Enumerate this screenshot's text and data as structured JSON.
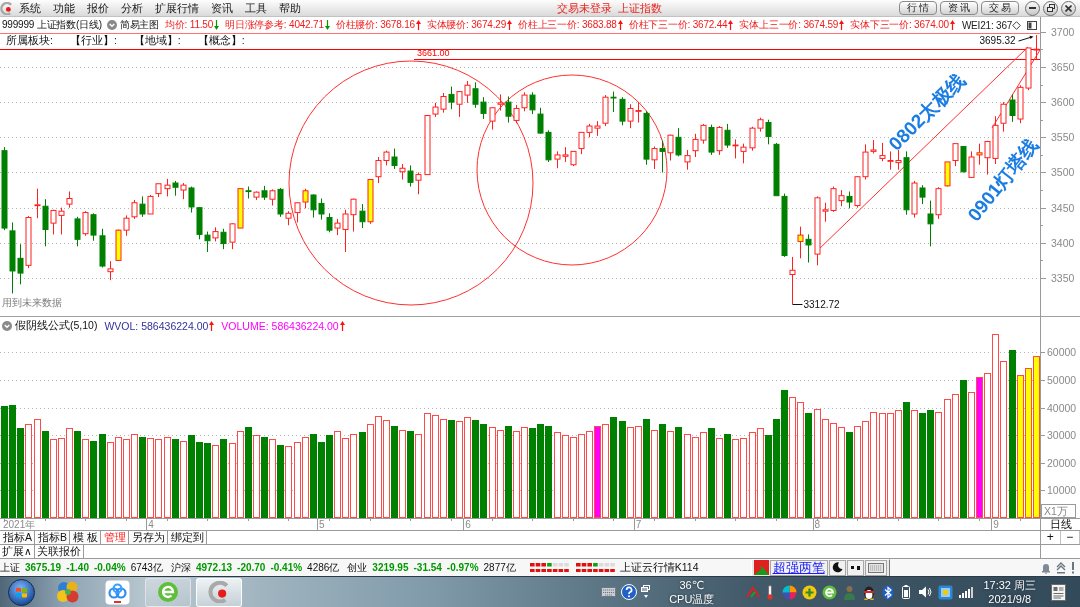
{
  "title_bar": {
    "menu": [
      "系统",
      "功能",
      "报价",
      "分析",
      "扩展行情",
      "资讯",
      "工具",
      "帮助"
    ],
    "login_status": "交易未登录",
    "index_name": "上证指数",
    "buttons": [
      "行 情",
      "资 讯",
      "交 易"
    ]
  },
  "info_bar": {
    "symbol": "999999 上证指数(日线)",
    "view": "简易主图",
    "indicators": [
      {
        "text": "均价: 11.50",
        "rising": false
      },
      {
        "text": "明日涨停参考: 4042.71",
        "rising": false
      },
      {
        "text": "价柱腰价: 3678.16",
        "rising": true
      },
      {
        "text": "实体腰价: 3674.29",
        "rising": true
      },
      {
        "text": "价柱上三一价: 3683.88",
        "rising": true
      },
      {
        "text": "价柱下三一价: 3672.44",
        "rising": true
      },
      {
        "text": "实体上三一价: 3674.59",
        "rising": true
      },
      {
        "text": "实体下三一价: 3674.00",
        "rising": true
      }
    ],
    "overflow_text": "WEI21: 367"
  },
  "sector_bar": [
    "所属板块:",
    "【行业】:",
    "【地域】:",
    "【概念】:"
  ],
  "price_chart": {
    "chart_data": [
      {
        "type": "candlestick",
        "ohlc": [
          [
            3531,
            3536,
            3418,
            3421
          ],
          [
            3417,
            3429,
            3328,
            3360
          ],
          [
            3378,
            3398,
            3341,
            3357
          ],
          [
            3368,
            3438,
            3364,
            3436
          ],
          [
            3453,
            3477,
            3435,
            3454
          ],
          [
            3452,
            3462,
            3395,
            3419
          ],
          [
            3428,
            3447,
            3412,
            3446
          ],
          [
            3439,
            3450,
            3412,
            3445
          ],
          [
            3455,
            3473,
            3450,
            3463
          ],
          [
            3434,
            3437,
            3395,
            3405
          ],
          [
            3413,
            3445,
            3410,
            3443
          ],
          [
            3440,
            3442,
            3403,
            3411
          ],
          [
            3410,
            3420,
            3365,
            3367
          ],
          [
            3359,
            3374,
            3347,
            3363
          ],
          [
            3375,
            3419,
            3375,
            3418
          ],
          [
            3418,
            3439,
            3410,
            3435
          ],
          [
            3437,
            3461,
            3434,
            3457
          ],
          [
            3455,
            3466,
            3437,
            3441
          ],
          [
            3441,
            3468,
            3441,
            3466
          ],
          [
            3470,
            3484,
            3465,
            3484
          ],
          [
            3477,
            3491,
            3466,
            3482
          ],
          [
            3485,
            3488,
            3467,
            3479
          ],
          [
            3475,
            3485,
            3462,
            3482
          ],
          [
            3478,
            3480,
            3443,
            3451
          ],
          [
            3450,
            3451,
            3405,
            3412
          ],
          [
            3411,
            3416,
            3387,
            3403
          ],
          [
            3407,
            3422,
            3402,
            3416
          ],
          [
            3415,
            3420,
            3391,
            3399
          ],
          [
            3401,
            3428,
            3391,
            3427
          ],
          [
            3421,
            3477,
            3421,
            3477
          ],
          [
            3474,
            3480,
            3463,
            3473
          ],
          [
            3465,
            3473,
            3461,
            3472
          ],
          [
            3474,
            3481,
            3461,
            3465
          ],
          [
            3462,
            3476,
            3453,
            3474
          ],
          [
            3476,
            3478,
            3437,
            3441
          ],
          [
            3435,
            3445,
            3425,
            3442
          ],
          [
            3443,
            3458,
            3429,
            3457
          ],
          [
            3458,
            3477,
            3449,
            3474
          ],
          [
            3468,
            3469,
            3436,
            3447
          ],
          [
            3456,
            3463,
            3433,
            3441
          ],
          [
            3436,
            3442,
            3415,
            3418
          ],
          [
            3421,
            3434,
            3411,
            3428
          ],
          [
            3419,
            3447,
            3387,
            3441
          ],
          [
            3440,
            3463,
            3416,
            3462
          ],
          [
            3445,
            3455,
            3421,
            3430
          ],
          [
            3430,
            3490,
            3427,
            3490
          ],
          [
            3494,
            3522,
            3485,
            3517
          ],
          [
            3517,
            3531,
            3510,
            3529
          ],
          [
            3522,
            3534,
            3505,
            3510
          ],
          [
            3501,
            3512,
            3490,
            3506
          ],
          [
            3502,
            3510,
            3480,
            3486
          ],
          [
            3489,
            3500,
            3469,
            3497
          ],
          [
            3497,
            3581,
            3497,
            3581
          ],
          [
            3583,
            3599,
            3579,
            3593
          ],
          [
            3590,
            3613,
            3585,
            3608
          ],
          [
            3611,
            3622,
            3590,
            3600
          ],
          [
            3597,
            3615,
            3579,
            3615
          ],
          [
            3610,
            3630,
            3599,
            3624
          ],
          [
            3619,
            3628,
            3592,
            3597
          ],
          [
            3600,
            3607,
            3576,
            3584
          ],
          [
            3573,
            3593,
            3561,
            3592
          ],
          [
            3597,
            3611,
            3588,
            3599
          ],
          [
            3600,
            3608,
            3571,
            3580
          ],
          [
            3574,
            3596,
            3570,
            3591
          ],
          [
            3592,
            3614,
            3587,
            3610
          ],
          [
            3610,
            3614,
            3583,
            3589
          ],
          [
            3583,
            3592,
            3555,
            3556
          ],
          [
            3557,
            3560,
            3515,
            3518
          ],
          [
            3519,
            3530,
            3506,
            3525
          ],
          [
            3523,
            3536,
            3515,
            3525
          ],
          [
            3511,
            3530,
            3509,
            3530
          ],
          [
            3534,
            3557,
            3526,
            3557
          ],
          [
            3557,
            3569,
            3550,
            3566
          ],
          [
            3563,
            3573,
            3552,
            3566
          ],
          [
            3570,
            3610,
            3566,
            3607
          ],
          [
            3607,
            3615,
            3586,
            3606
          ],
          [
            3604,
            3607,
            3567,
            3573
          ],
          [
            3573,
            3597,
            3563,
            3591
          ],
          [
            3587,
            3600,
            3571,
            3588
          ],
          [
            3584,
            3587,
            3511,
            3519
          ],
          [
            3518,
            3537,
            3505,
            3534
          ],
          [
            3534,
            3545,
            3500,
            3530
          ],
          [
            3528,
            3554,
            3517,
            3553
          ],
          [
            3550,
            3563,
            3523,
            3525
          ],
          [
            3515,
            3532,
            3504,
            3524
          ],
          [
            3531,
            3555,
            3522,
            3547
          ],
          [
            3546,
            3569,
            3541,
            3567
          ],
          [
            3564,
            3568,
            3525,
            3529
          ],
          [
            3531,
            3566,
            3525,
            3564
          ],
          [
            3560,
            3569,
            3535,
            3539
          ],
          [
            3538,
            3547,
            3520,
            3539
          ],
          [
            3530,
            3541,
            3513,
            3536
          ],
          [
            3535,
            3565,
            3531,
            3563
          ],
          [
            3563,
            3578,
            3558,
            3575
          ],
          [
            3571,
            3575,
            3540,
            3551
          ],
          [
            3540,
            3542,
            3467,
            3467
          ],
          [
            3466,
            3470,
            3380,
            3382
          ],
          [
            3355,
            3380,
            3312.72,
            3361
          ],
          [
            3402,
            3423,
            3378,
            3411
          ],
          [
            3405,
            3412,
            3372,
            3397
          ],
          [
            3384,
            3466,
            3368,
            3464
          ],
          [
            3445,
            3457,
            3430,
            3447
          ],
          [
            3446,
            3480,
            3444,
            3477
          ],
          [
            3460,
            3475,
            3452,
            3467
          ],
          [
            3466,
            3473,
            3449,
            3458
          ],
          [
            3453,
            3495,
            3450,
            3494
          ],
          [
            3494,
            3540,
            3490,
            3529
          ],
          [
            3530,
            3546,
            3527,
            3532
          ],
          [
            3520,
            3542,
            3516,
            3524
          ],
          [
            3516,
            3530,
            3504,
            3517
          ],
          [
            3514,
            3532,
            3504,
            3517
          ],
          [
            3521,
            3530,
            3440,
            3447
          ],
          [
            3441,
            3488,
            3436,
            3485
          ],
          [
            3478,
            3482,
            3455,
            3465
          ],
          [
            3441,
            3460,
            3395,
            3427
          ],
          [
            3440,
            3479,
            3434,
            3477
          ],
          [
            3481,
            3515,
            3480,
            3515
          ],
          [
            3517,
            3541,
            3509,
            3541
          ],
          [
            3537,
            3537,
            3500,
            3501
          ],
          [
            3493,
            3530,
            3493,
            3522
          ],
          [
            3525,
            3541,
            3511,
            3528
          ],
          [
            3521,
            3545,
            3497,
            3544
          ],
          [
            3520,
            3580,
            3512,
            3567
          ],
          [
            3570,
            3600,
            3558,
            3597
          ],
          [
            3603,
            3611,
            3572,
            3581
          ],
          [
            3576,
            3624,
            3570,
            3621
          ],
          [
            3620,
            3677,
            3617,
            3677
          ],
          [
            3675,
            3695.32,
            3660,
            3675.19
          ]
        ],
        "colors": [
          "#008000",
          "#008000",
          "#008000",
          "#ffffff",
          "#ffffff",
          "#008000",
          "#ffffff",
          "#ffffff",
          "#ffffff",
          "#008000",
          "#ffffff",
          "#008000",
          "#008000",
          "#ffffff",
          "#ffff00",
          "#ffffff",
          "#ffffff",
          "#008000",
          "#ffffff",
          "#ffffff",
          "#ffffff",
          "#008000",
          "#ffffff",
          "#008000",
          "#008000",
          "#008000",
          "#ffffff",
          "#008000",
          "#ffffff",
          "#ffff00",
          "#008000",
          "#ffffff",
          "#008000",
          "#ffffff",
          "#008000",
          "#ffffff",
          "#ffffff",
          "#ffff00",
          "#008000",
          "#008000",
          "#008000",
          "#ffffff",
          "#ffffff",
          "#ffffff",
          "#008000",
          "#ffff00",
          "#ffffff",
          "#ffffff",
          "#008000",
          "#ffffff",
          "#008000",
          "#ffffff",
          "#ffffff",
          "#ffffff",
          "#ffffff",
          "#008000",
          "#ffffff",
          "#ffffff",
          "#008000",
          "#008000",
          "#ffffff",
          "#ffffff",
          "#008000",
          "#ffffff",
          "#ffffff",
          "#008000",
          "#008000",
          "#008000",
          "#ffffff",
          "#ffffff",
          "#ffffff",
          "#ffffff",
          "#ffffff",
          "#ffffff",
          "#ffffff",
          "#008000",
          "#008000",
          "#ffffff",
          "#ffffff",
          "#008000",
          "#ffffff",
          "#008000",
          "#ffffff",
          "#008000",
          "#ffffff",
          "#ffffff",
          "#ffffff",
          "#008000",
          "#ffffff",
          "#008000",
          "#ffffff",
          "#ffffff",
          "#ffffff",
          "#ffffff",
          "#008000",
          "#008000",
          "#008000",
          "#ffffff",
          "#ffff00",
          "#008000",
          "#ffffff",
          "#ffffff",
          "#ffffff",
          "#ffffff",
          "#008000",
          "#ffffff",
          "#ffffff",
          "#ffffff",
          "#ffffff",
          "#ffffff",
          "#ffffff",
          "#008000",
          "#ffffff",
          "#008000",
          "#008000",
          "#ffffff",
          "#ffff00",
          "#ffffff",
          "#008000",
          "#ffffff",
          "#ffff00",
          "#ffffff",
          "#ffffff",
          "#ffffff",
          "#008000",
          "#ffffff",
          "#ffffff",
          "#ffffff"
        ],
        "yticks": [
          3350,
          3400,
          3450,
          3500,
          3550,
          3600,
          3650,
          3700
        ],
        "ylim": [
          3296,
          3721
        ],
        "tick_labels": "y",
        "grid": "y",
        "ref_lines": [
          {
            "axis": "y",
            "value": 3675,
            "color": "#ff0000"
          },
          {
            "axis": "y",
            "value": 3661,
            "label": "3661.00",
            "color": "#ff0000"
          }
        ],
        "annotations": [
          "3695.32",
          "3312.72"
        ]
      }
    ],
    "note": "用到未来数据",
    "trend_lines": [
      {
        "label": "0802太极线"
      },
      {
        "label": "0901灯塔线"
      }
    ]
  },
  "volume_chart": {
    "formula": "假阴线公式(5,10)",
    "readings": [
      {
        "text": "WVOL: 586436224.00",
        "color": "#333399",
        "rising": true
      },
      {
        "text": "VOLUME: 586436224.00",
        "color": "#ff00ff",
        "rising": true
      }
    ],
    "chart_data": [
      {
        "type": "bar",
        "xlabel": "2021年",
        "categories": [
          null,
          null,
          null,
          null,
          null,
          null,
          null,
          null,
          null,
          null,
          null,
          null,
          null,
          null,
          null,
          null,
          null,
          null,
          "4",
          null,
          null,
          null,
          null,
          null,
          null,
          null,
          null,
          null,
          null,
          null,
          null,
          null,
          null,
          null,
          null,
          null,
          null,
          null,
          null,
          "5",
          null,
          null,
          null,
          null,
          null,
          null,
          null,
          null,
          null,
          null,
          null,
          null,
          null,
          null,
          null,
          null,
          null,
          "6",
          null,
          null,
          null,
          null,
          null,
          null,
          null,
          null,
          null,
          null,
          null,
          null,
          null,
          null,
          null,
          null,
          null,
          null,
          null,
          null,
          "7",
          null,
          null,
          null,
          null,
          null,
          null,
          null,
          null,
          null,
          null,
          null,
          null,
          null,
          null,
          null,
          null,
          null,
          null,
          null,
          null,
          null,
          "8",
          null,
          null,
          null,
          null,
          null,
          null,
          null,
          null,
          null,
          null,
          null,
          null,
          null,
          null,
          null,
          null,
          null,
          null,
          null,
          null,
          null,
          "9",
          null,
          null,
          null,
          null,
          null
        ],
        "values": [
          40500,
          41000,
          32500,
          34000,
          36000,
          31500,
          28500,
          29000,
          32500,
          31500,
          28500,
          28000,
          30500,
          27500,
          29500,
          28500,
          30500,
          29500,
          29000,
          28500,
          29500,
          28500,
          28000,
          30000,
          27500,
          27000,
          26500,
          28500,
          27000,
          31500,
          33000,
          30000,
          29500,
          28500,
          26500,
          26000,
          27500,
          29500,
          30500,
          27500,
          30000,
          31500,
          29000,
          30500,
          31000,
          34000,
          37000,
          35500,
          33500,
          32000,
          31500,
          30500,
          38000,
          37500,
          36000,
          35500,
          35000,
          36500,
          35500,
          34000,
          33000,
          32000,
          33500,
          31500,
          33000,
          32500,
          34000,
          33500,
          31000,
          30000,
          29500,
          30500,
          31500,
          33500,
          34000,
          36500,
          35000,
          33000,
          33500,
          36000,
          32000,
          34000,
          31500,
          33000,
          30500,
          29500,
          31000,
          32500,
          29000,
          30500,
          28500,
          29000,
          31000,
          32500,
          30000,
          36000,
          46500,
          44000,
          42000,
          38000,
          39500,
          36000,
          34500,
          33000,
          31000,
          33500,
          35000,
          38500,
          38000,
          38000,
          39000,
          42000,
          39000,
          38000,
          39000,
          38500,
          43000,
          45000,
          50000,
          45500,
          51000,
          52500,
          66500,
          57000,
          61000,
          52000,
          54500,
          58600
        ],
        "colors": [
          "#008000",
          "#008000",
          "#008000",
          "#ffffff",
          "#ffffff",
          "#008000",
          "#ffffff",
          "#ffffff",
          "#ffffff",
          "#008000",
          "#ffffff",
          "#008000",
          "#008000",
          "#ffffff",
          "#ffffff",
          "#ffffff",
          "#ffffff",
          "#008000",
          "#ffffff",
          "#ffffff",
          "#ffffff",
          "#008000",
          "#ffffff",
          "#008000",
          "#008000",
          "#008000",
          "#ffffff",
          "#008000",
          "#ffffff",
          "#ffffff",
          "#008000",
          "#ffffff",
          "#008000",
          "#ffffff",
          "#008000",
          "#ffffff",
          "#ffffff",
          "#ffffff",
          "#008000",
          "#008000",
          "#008000",
          "#ffffff",
          "#ffffff",
          "#ffffff",
          "#008000",
          "#ffffff",
          "#ffffff",
          "#ffffff",
          "#008000",
          "#ffffff",
          "#008000",
          "#ffffff",
          "#ffffff",
          "#ffffff",
          "#ffffff",
          "#008000",
          "#ffffff",
          "#ffffff",
          "#008000",
          "#008000",
          "#ffffff",
          "#ffffff",
          "#008000",
          "#ffffff",
          "#ffffff",
          "#008000",
          "#008000",
          "#008000",
          "#ffffff",
          "#ffffff",
          "#ffffff",
          "#ffffff",
          "#ffffff",
          "#ff00ff",
          "#ffffff",
          "#008000",
          "#008000",
          "#ffffff",
          "#ffffff",
          "#008000",
          "#ffffff",
          "#008000",
          "#ffffff",
          "#008000",
          "#ffffff",
          "#ffffff",
          "#ffffff",
          "#008000",
          "#ffffff",
          "#008000",
          "#ffffff",
          "#ffffff",
          "#ffffff",
          "#ffffff",
          "#008000",
          "#008000",
          "#008000",
          "#ffffff",
          "#ffffff",
          "#008000",
          "#ffffff",
          "#ffffff",
          "#ffffff",
          "#ffffff",
          "#008000",
          "#ffffff",
          "#ffffff",
          "#ffffff",
          "#ffffff",
          "#ffffff",
          "#ffffff",
          "#008000",
          "#ffffff",
          "#008000",
          "#008000",
          "#ffffff",
          "#ffffff",
          "#ffffff",
          "#008000",
          "#ffffff",
          "#ff00ff",
          "#ffffff",
          "#ffffff",
          "#ffffff",
          "#008000",
          "#ffff00",
          "#ffff00",
          "#ffff00"
        ],
        "yticks": [
          10000,
          20000,
          30000,
          40000,
          50000,
          60000
        ],
        "ylim": [
          0,
          73200
        ],
        "ylabel": "X1万",
        "grid": "y"
      }
    ]
  },
  "date_axis": {
    "period": "日线"
  },
  "tabs": [
    {
      "label": "指标A",
      "selected": false
    },
    {
      "label": "指标B",
      "selected": false
    },
    {
      "label": "模 板",
      "selected": false
    },
    {
      "label": "管理",
      "selected": true
    },
    {
      "label": "另存为",
      "selected": false
    },
    {
      "label": "绑定到",
      "selected": false
    }
  ],
  "zoom_buttons": [
    "+",
    "−"
  ],
  "extension_tabs": [
    "扩展∧",
    "关联报价"
  ],
  "index_bar": {
    "indices": [
      {
        "name": "上证",
        "value": "3675.19",
        "change": "-1.40",
        "percent": "-0.04%",
        "turnover": "6743亿",
        "rising": false
      },
      {
        "name": "沪深",
        "value": "4972.13",
        "change": "-20.70",
        "percent": "-0.41%",
        "turnover": "4286亿",
        "rising": false
      },
      {
        "name": "创业",
        "value": "3219.95",
        "change": "-31.54",
        "percent": "-0.97%",
        "turnover": "2877亿",
        "rising": false
      }
    ],
    "feed": "上证云行情K114",
    "link": "超强两笔"
  },
  "taskbar": {
    "windows": [
      {
        "selected": false
      },
      {
        "selected": true
      }
    ],
    "temperature": "36℃",
    "sensor": "CPU温度",
    "time": "17:32 周三",
    "date": "2021/9/8"
  }
}
